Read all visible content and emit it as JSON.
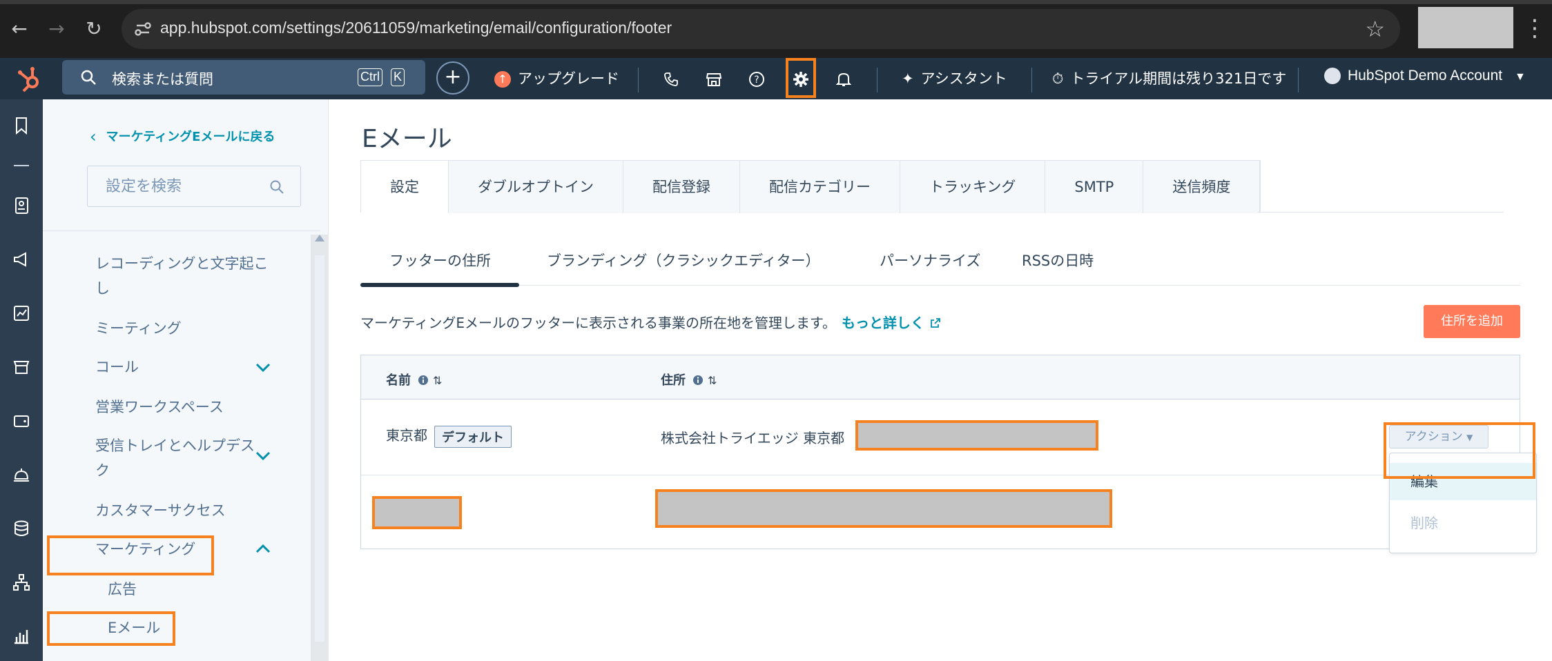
{
  "browser": {
    "url": "app.hubspot.com/settings/20611059/marketing/email/configuration/footer",
    "back_icon": "arrow-left-icon",
    "forward_icon": "arrow-right-icon",
    "reload_icon": "reload-icon"
  },
  "topnav": {
    "search_label": "検索または質問",
    "kbd_ctrl": "Ctrl",
    "kbd_k": "K",
    "upgrade_label": "アップグレード",
    "assistant_label": "アシスタント",
    "trial_label": "トライアル期間は残り321日です",
    "account_label": "HubSpot Demo Account",
    "brand_color": "#ff7a59",
    "bg_color": "#213343"
  },
  "sidebar": {
    "back_label": "マーケティングEメールに戻る",
    "search_placeholder": "設定を検索",
    "items": [
      {
        "label": "レコーディングと文字起こ"
      },
      {
        "label": "し"
      },
      {
        "label": "ミーティング"
      },
      {
        "label": "コール"
      },
      {
        "label": "営業ワークスペース"
      },
      {
        "label": "受信トレイとヘルプデス"
      },
      {
        "label": "ク"
      },
      {
        "label": "カスタマーサクセス"
      },
      {
        "label": "マーケティング"
      },
      {
        "label": "広告"
      },
      {
        "label": "Eメール"
      }
    ]
  },
  "main": {
    "title": "Eメール",
    "tabs": [
      {
        "label": "設定"
      },
      {
        "label": "ダブルオプトイン"
      },
      {
        "label": "配信登録"
      },
      {
        "label": "配信カテゴリー"
      },
      {
        "label": "トラッキング"
      },
      {
        "label": "SMTP"
      },
      {
        "label": "送信頻度"
      }
    ],
    "subtabs": [
      {
        "label": "フッターの住所"
      },
      {
        "label": "ブランディング（クラシックエディター）"
      },
      {
        "label": "パーソナライズ"
      },
      {
        "label": "RSSの日時"
      }
    ],
    "description": "マーケティングEメールのフッターに表示される事業の所在地を管理します。",
    "learn_more": "もっと詳しく",
    "add_button": "住所を追加",
    "table": {
      "columns": [
        {
          "label": "名前"
        },
        {
          "label": "住所"
        }
      ],
      "rows": [
        {
          "name": "東京都",
          "badge": "デフォルト",
          "address": "株式会社トライエッジ 東京都"
        }
      ]
    },
    "action_button": "アクション",
    "action_menu": [
      {
        "label": "編集"
      },
      {
        "label": "削除"
      }
    ]
  },
  "colors": {
    "highlight": "#f5821f",
    "link": "#0091ae",
    "redaction": "#c4c4c4"
  }
}
